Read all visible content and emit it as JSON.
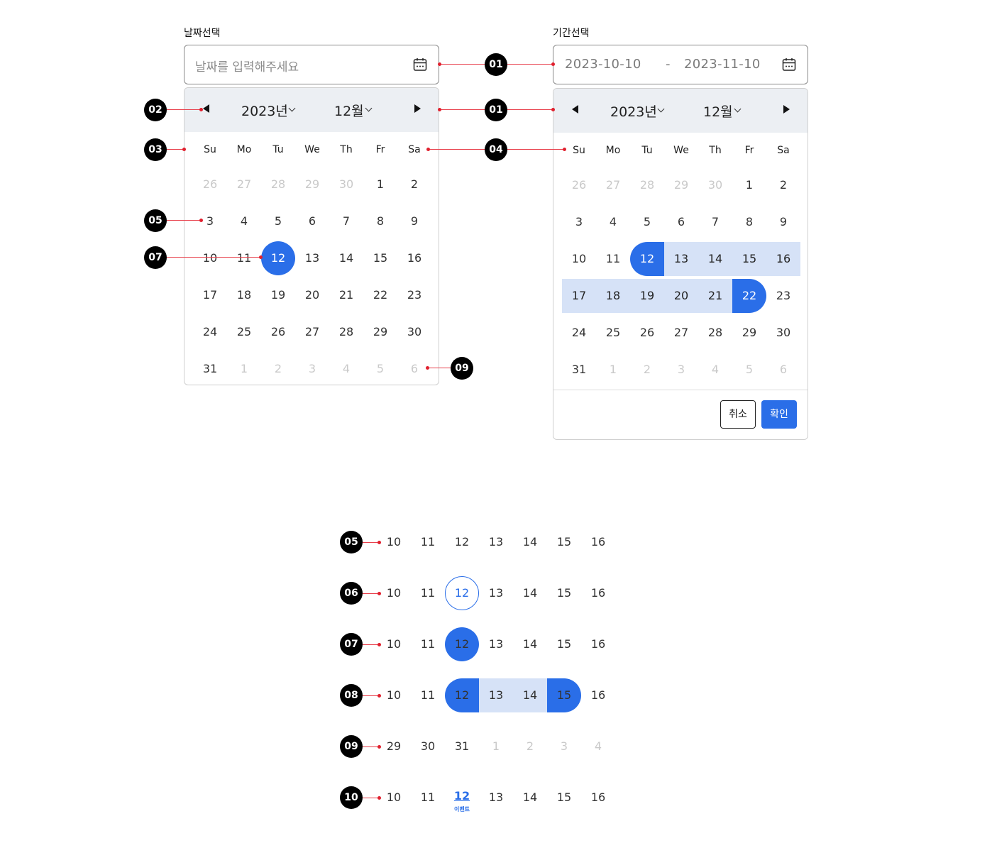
{
  "single": {
    "label": "날짜선택",
    "placeholder": "날짜를 입력해주세요",
    "year": "2023년",
    "month": "12월",
    "weekdays": [
      "Su",
      "Mo",
      "Tu",
      "We",
      "Th",
      "Fr",
      "Sa"
    ],
    "weeks": [
      [
        "26",
        "27",
        "28",
        "29",
        "30",
        "1",
        "2"
      ],
      [
        "3",
        "4",
        "5",
        "6",
        "7",
        "8",
        "9"
      ],
      [
        "10",
        "11",
        "12",
        "13",
        "14",
        "15",
        "16"
      ],
      [
        "17",
        "18",
        "19",
        "20",
        "21",
        "22",
        "23"
      ],
      [
        "24",
        "25",
        "26",
        "27",
        "28",
        "29",
        "30"
      ],
      [
        "31",
        "1",
        "2",
        "3",
        "4",
        "5",
        "6"
      ]
    ],
    "selected": "12"
  },
  "range": {
    "label": "기간선택",
    "start": "2023-10-10",
    "separator": "-",
    "end": "2023-11-10",
    "year": "2023년",
    "month": "12월",
    "weekdays": [
      "Su",
      "Mo",
      "Tu",
      "We",
      "Th",
      "Fr",
      "Sa"
    ],
    "weeks": [
      [
        "26",
        "27",
        "28",
        "29",
        "30",
        "1",
        "2"
      ],
      [
        "3",
        "4",
        "5",
        "6",
        "7",
        "8",
        "9"
      ],
      [
        "10",
        "11",
        "12",
        "13",
        "14",
        "15",
        "16"
      ],
      [
        "17",
        "18",
        "19",
        "20",
        "21",
        "22",
        "23"
      ],
      [
        "24",
        "25",
        "26",
        "27",
        "28",
        "29",
        "30"
      ],
      [
        "31",
        "1",
        "2",
        "3",
        "4",
        "5",
        "6"
      ]
    ],
    "range_start": "12",
    "range_end": "22",
    "cancel_label": "취소",
    "ok_label": "확인"
  },
  "callouts": {
    "single": [
      "02",
      "03",
      "05",
      "07",
      "09"
    ],
    "connector": [
      "01",
      "01",
      "04"
    ]
  },
  "states": [
    {
      "badge": "05",
      "days": [
        "10",
        "11",
        "12",
        "13",
        "14",
        "15",
        "16"
      ],
      "kind": "default"
    },
    {
      "badge": "06",
      "days": [
        "10",
        "11",
        "12",
        "13",
        "14",
        "15",
        "16"
      ],
      "kind": "today"
    },
    {
      "badge": "07",
      "days": [
        "10",
        "11",
        "12",
        "13",
        "14",
        "15",
        "16"
      ],
      "kind": "selected"
    },
    {
      "badge": "08",
      "days": [
        "10",
        "11",
        "12",
        "13",
        "14",
        "15",
        "16"
      ],
      "kind": "range"
    },
    {
      "badge": "09",
      "days": [
        "29",
        "30",
        "31",
        "1",
        "2",
        "3",
        "4"
      ],
      "kind": "outside"
    },
    {
      "badge": "10",
      "days": [
        "10",
        "11",
        "12",
        "13",
        "14",
        "15",
        "16"
      ],
      "kind": "event",
      "event_label": "이벤트"
    }
  ],
  "colors": {
    "accent": "#2a6ee8",
    "range_fill": "#d6e2f7",
    "header_bg": "#eceff3",
    "callout_line": "#e8404c"
  },
  "icons": [
    "calendar-icon",
    "triangle-left-icon",
    "triangle-right-icon",
    "chevron-down-icon"
  ]
}
